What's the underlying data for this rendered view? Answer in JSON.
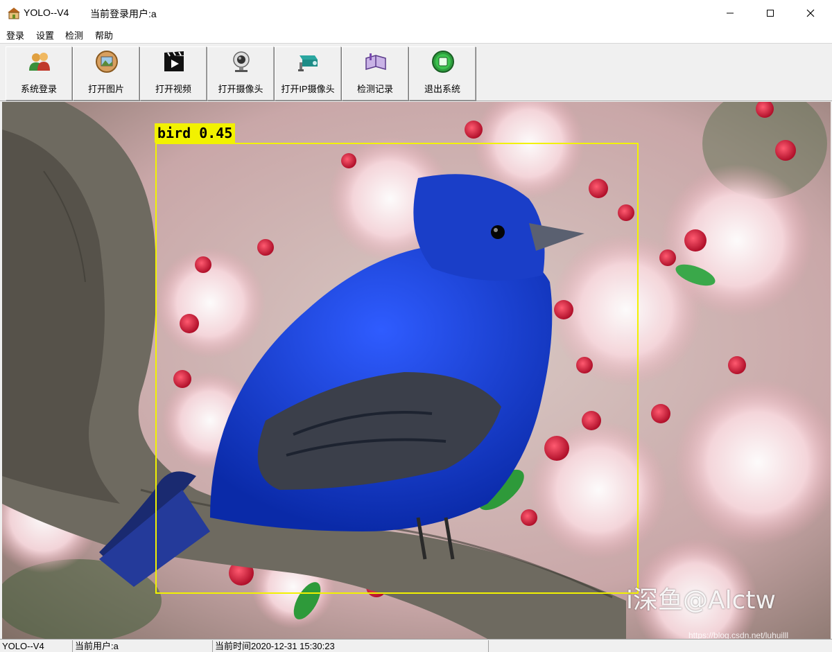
{
  "window": {
    "app_title": "YOLO--V4",
    "user_title": "当前登录用户:a",
    "icons": {
      "app": "house-icon",
      "minimize": "minimize-icon",
      "maximize": "maximize-icon",
      "close": "close-icon"
    }
  },
  "menu": {
    "items": [
      {
        "label": "登录"
      },
      {
        "label": "设置"
      },
      {
        "label": "检测"
      },
      {
        "label": "帮助"
      }
    ]
  },
  "toolbar": {
    "buttons": [
      {
        "label": "系统登录",
        "icon": "users-icon"
      },
      {
        "label": "打开图片",
        "icon": "image-icon"
      },
      {
        "label": "打开视频",
        "icon": "video-clapper-icon"
      },
      {
        "label": "打开摄像头",
        "icon": "webcam-icon"
      },
      {
        "label": "打开IP摄像头",
        "icon": "ip-camera-icon"
      },
      {
        "label": "检测记录",
        "icon": "book-icon"
      },
      {
        "label": "退出系统",
        "icon": "exit-icon"
      }
    ]
  },
  "detection": {
    "label": "bird 0.45",
    "box_color": "#f2f200"
  },
  "watermark": {
    "text": "i深鱼@Alctw",
    "url": "https://blog.csdn.net/luhuilll"
  },
  "statusbar": {
    "app": "YOLO--V4",
    "user": "当前用户:a",
    "time": "当前时间2020-12-31 15:30:23"
  }
}
